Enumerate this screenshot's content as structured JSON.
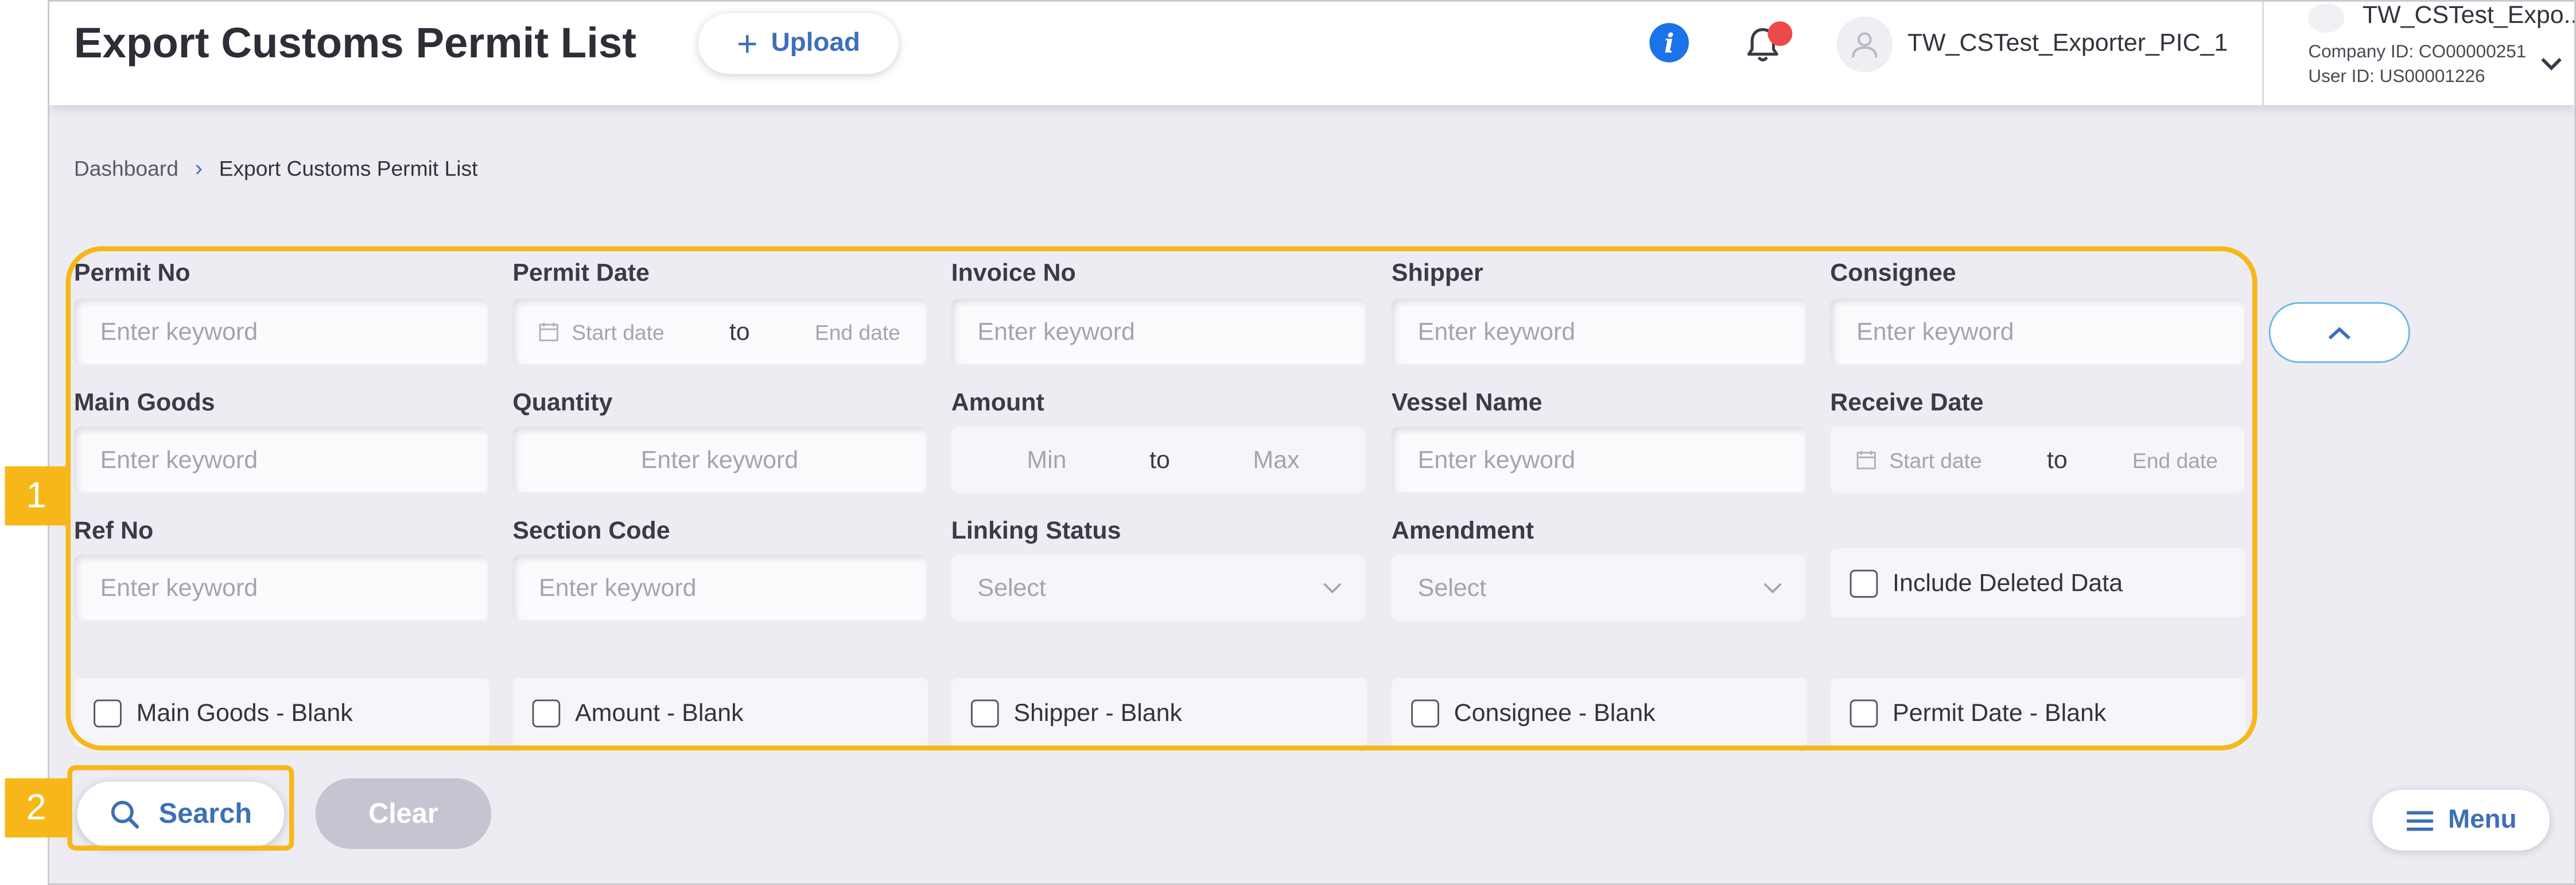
{
  "header": {
    "title": "Export Customs Permit List",
    "upload_label": "Upload",
    "user_name": "TW_CSTest_Exporter_PIC_1",
    "company_name": "TW_CSTest_Expo...",
    "company_id": "Company ID: CO00000251",
    "user_id": "User ID: US00001226"
  },
  "breadcrumb": {
    "home": "Dashboard",
    "current": "Export Customs Permit List"
  },
  "filters": {
    "permit_no": {
      "label": "Permit No",
      "placeholder": "Enter keyword"
    },
    "permit_date": {
      "label": "Permit Date",
      "start": "Start date",
      "to": "to",
      "end": "End date"
    },
    "invoice_no": {
      "label": "Invoice No",
      "placeholder": "Enter keyword"
    },
    "shipper": {
      "label": "Shipper",
      "placeholder": "Enter keyword"
    },
    "consignee": {
      "label": "Consignee",
      "placeholder": "Enter keyword"
    },
    "main_goods": {
      "label": "Main Goods",
      "placeholder": "Enter keyword"
    },
    "quantity": {
      "label": "Quantity",
      "placeholder": "Enter keyword"
    },
    "amount": {
      "label": "Amount",
      "min": "Min",
      "to": "to",
      "max": "Max"
    },
    "vessel_name": {
      "label": "Vessel Name",
      "placeholder": "Enter keyword"
    },
    "receive_date": {
      "label": "Receive Date",
      "start": "Start date",
      "to": "to",
      "end": "End date"
    },
    "ref_no": {
      "label": "Ref No",
      "placeholder": "Enter keyword"
    },
    "section_code": {
      "label": "Section Code",
      "placeholder": "Enter keyword"
    },
    "linking_status": {
      "label": "Linking Status",
      "value": "Select"
    },
    "amendment": {
      "label": "Amendment",
      "value": "Select"
    },
    "include_deleted": "Include Deleted Data",
    "blank_checks": [
      "Main Goods - Blank",
      "Amount - Blank",
      "Shipper - Blank",
      "Consignee - Blank",
      "Permit Date - Blank"
    ]
  },
  "actions": {
    "search": "Search",
    "clear": "Clear",
    "menu": "Menu"
  },
  "annotations": {
    "one": "1",
    "two": "2"
  },
  "colors": {
    "accent": "#3e6fb8",
    "annotation": "#f7b718",
    "info": "#1a73e8",
    "badge": "#ec4a4a"
  }
}
